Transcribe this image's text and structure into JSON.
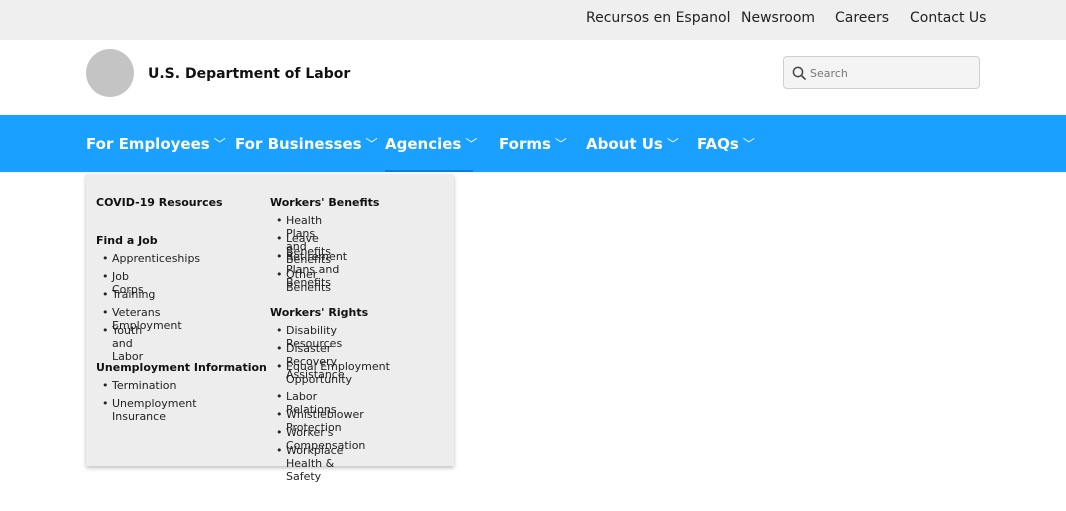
{
  "utility_nav": {
    "links": [
      "Recursos en Espanol",
      "Newsroom",
      "Careers",
      "Contact Us"
    ]
  },
  "header": {
    "site_title": "U.S. Department of Labor",
    "search_placeholder": "Search"
  },
  "main_nav": {
    "items": [
      "For Employees",
      "For Businesses",
      "Agencies",
      "Forms",
      "About Us",
      "FAQs"
    ],
    "chevron": "﹀",
    "active": "Agencies"
  },
  "dropdown": {
    "col1": {
      "covid": "COVID-19 Resources",
      "find_job": {
        "title": "Find a Job",
        "items": [
          "Apprenticeships",
          "Job Corps",
          "Training",
          "Veterans Employment",
          "Youth and Labor"
        ]
      },
      "unemployment": {
        "title": "Unemployment Information",
        "items": [
          "Termination",
          "Unemployment Insurance"
        ]
      }
    },
    "col2": {
      "benefits": {
        "title": "Workers' Benefits",
        "items": [
          "Health Plans and Benefits",
          "Leave Benefits",
          "Retirement Plans and Benefits",
          "Other Benefits"
        ]
      },
      "rights": {
        "title": "Workers' Rights",
        "items": [
          "Disability Resources",
          "Disaster Recovery Assistance",
          "Equal Employment Opportunity",
          "Labor Relations",
          "Whistleblower Protection",
          "Worker's Compensation",
          "Workplace Health & Safety"
        ]
      }
    }
  },
  "colors": {
    "nav_background": "#1aa1ff",
    "utility_background": "#efefef",
    "dropdown_background": "#ededed"
  }
}
